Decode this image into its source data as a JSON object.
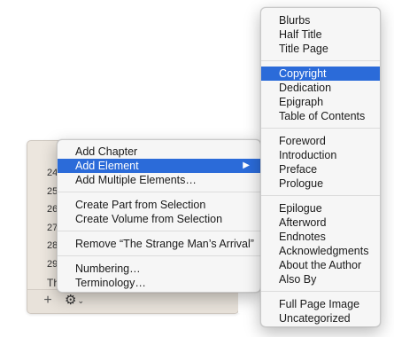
{
  "chapter_list": {
    "numbers": [
      "24",
      "25",
      "26",
      "27",
      "28",
      "29",
      "Th"
    ]
  },
  "toolbar": {
    "add_label": "+",
    "gear_label": "⚙",
    "chevron_label": "⌄"
  },
  "main_menu": {
    "groups": [
      [
        "Add Chapter",
        "Add Element",
        "Add Multiple Elements…"
      ],
      [
        "Create Part from Selection",
        "Create Volume from Selection"
      ],
      [
        "Remove “The Strange Man’s Arrival”"
      ],
      [
        "Numbering…",
        "Terminology…"
      ]
    ],
    "selected": "Add Element",
    "submenu_arrow": "▶"
  },
  "element_submenu": {
    "groups": [
      [
        "Blurbs",
        "Half Title",
        "Title Page"
      ],
      [
        "Copyright",
        "Dedication",
        "Epigraph",
        "Table of Contents"
      ],
      [
        "Foreword",
        "Introduction",
        "Preface",
        "Prologue"
      ],
      [
        "Epilogue",
        "Afterword",
        "Endnotes",
        "Acknowledgments",
        "About the Author",
        "Also By"
      ],
      [
        "Full Page Image",
        "Uncategorized"
      ]
    ],
    "selected": "Copyright"
  },
  "colors": {
    "selection": "#2b6bd9",
    "panel_background": "#ece6de",
    "menu_background": "#f6f6f6"
  }
}
